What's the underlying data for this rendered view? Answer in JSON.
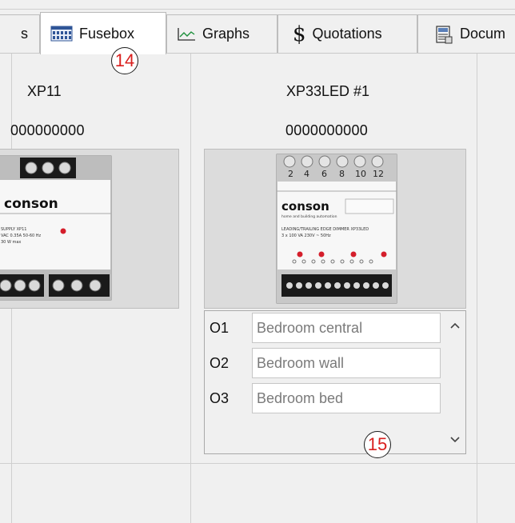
{
  "tabs": [
    {
      "label": "s",
      "icon": "partial-tab",
      "active": false
    },
    {
      "label": "Fusebox",
      "icon": "fusebox-icon",
      "active": true
    },
    {
      "label": "Graphs",
      "icon": "graph-icon",
      "active": false
    },
    {
      "label": "Quotations",
      "icon": "dollar-icon",
      "active": false
    },
    {
      "label": "Docum",
      "icon": "document-icon",
      "active": false
    }
  ],
  "callouts": {
    "tab": "14",
    "outputs": "15"
  },
  "devices": [
    {
      "name": "XP11",
      "serial": "000000000",
      "faceplate": {
        "brand": "conson",
        "text1": "SUPPLY XP11",
        "text2": "VAC  0.35A  50-60 Hz",
        "text3": "30 W max"
      }
    },
    {
      "name": "XP33LED  #1",
      "serial": "0000000000",
      "faceplate": {
        "brand": "conson",
        "tagline": "home and building automation",
        "terminals": [
          "2",
          "4",
          "6",
          "8",
          "10",
          "12"
        ],
        "title": "LEADING/TRAILING EDGE DIMMER XP33LED",
        "spec": "3 x 100 VA  230V ~ 50Hz"
      }
    }
  ],
  "outputs": [
    {
      "label": "O1",
      "value": "Bedroom central"
    },
    {
      "label": "O2",
      "value": "Bedroom wall"
    },
    {
      "label": "O3",
      "value": "Bedroom bed"
    }
  ],
  "colors": {
    "callout_text": "#d9201f",
    "led": "#d41e2b",
    "panel_bg": "#f0f0f0"
  }
}
